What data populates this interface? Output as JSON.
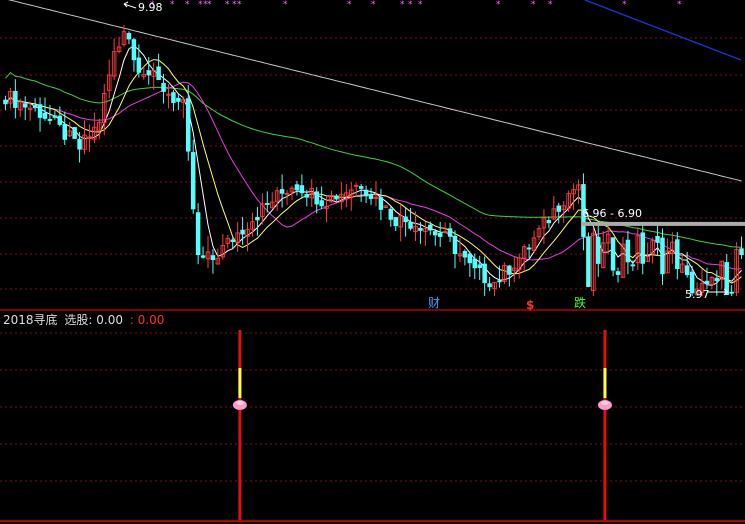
{
  "colors": {
    "background": "#000000",
    "border": "#b40000",
    "grid": "#7a1010",
    "up_candle": "#ff3c3c",
    "down_candle": "#54ffff",
    "ma5": "#ffffff",
    "ma10": "#ffff66",
    "ma20": "#e040e0",
    "ma60": "#40d040",
    "ma120": "#c8c8c8",
    "trendline": "#2030d0",
    "marker": "#ff66ff",
    "signal_bar": "#e01010",
    "signal_bar_top": "#ffff40",
    "signal_knob": "#ff99cc",
    "tag_cai": "#40a0ff",
    "tag_dollar": "#ff3030",
    "tag_die": "#40ff40",
    "band": "#aaaaaa"
  },
  "price_panel": {
    "high_label": "9.98",
    "low_label": "5.97",
    "range_label": "6.96 - 6.90",
    "tags": {
      "cai": "财",
      "dollar": "$",
      "die": "跌"
    },
    "top_marker_glyph": "*"
  },
  "indicator_panel": {
    "title": "2018寻底",
    "series_label": "选股:",
    "value_white": "0.00",
    "value_red": ": 0.00"
  },
  "chart_data": [
    {
      "type": "candlestick",
      "title": "",
      "annotations": [
        "9.98",
        "5.97",
        "6.96 - 6.90",
        "财",
        "$",
        "跌"
      ],
      "highest": 9.98,
      "lowest": 5.97,
      "band_range": [
        6.9,
        6.96
      ],
      "series": [
        {
          "name": "MA5"
        },
        {
          "name": "MA10"
        },
        {
          "name": "MA20"
        },
        {
          "name": "MA60"
        },
        {
          "name": "MA120"
        }
      ]
    },
    {
      "type": "bar",
      "title": "2018寻底",
      "series_name": "选股",
      "value": 0.0,
      "signals": [
        {
          "position": 0.322,
          "value": 1
        },
        {
          "position": 0.812,
          "value": 1
        }
      ],
      "ylim": [
        0,
        1
      ]
    }
  ]
}
